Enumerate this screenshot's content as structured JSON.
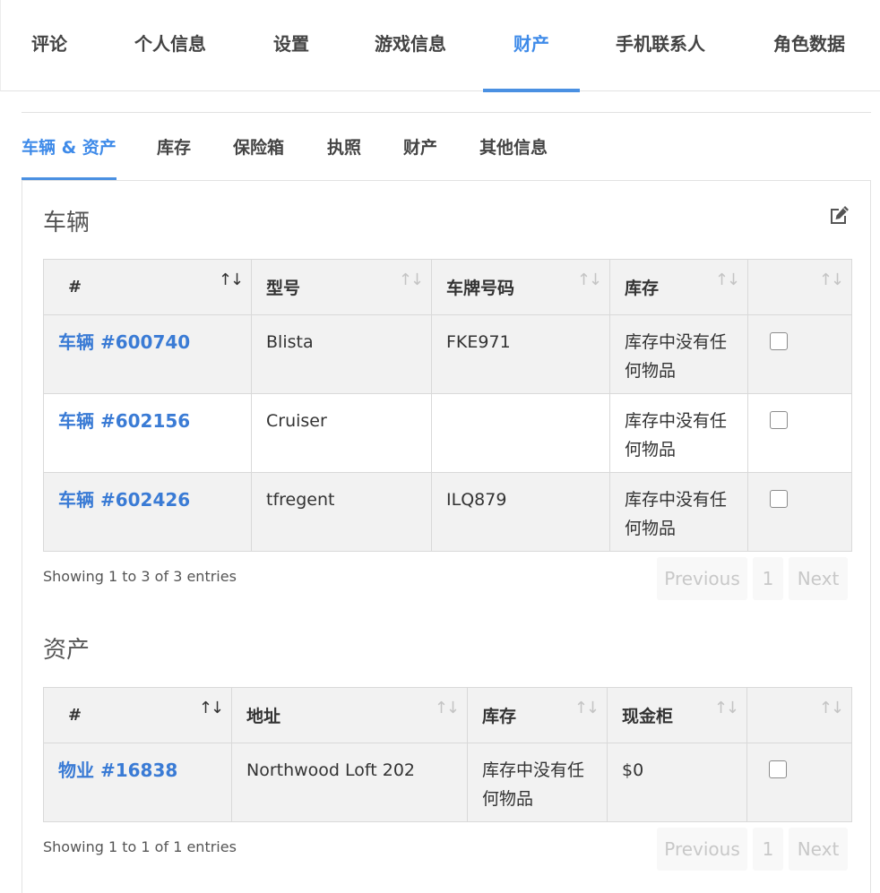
{
  "top_tabs": [
    "评论",
    "个人信息",
    "设置",
    "游戏信息",
    "财产",
    "手机联系人",
    "角色数据"
  ],
  "active_top_tab": "财产",
  "sub_tabs": [
    "车辆 & 资产",
    "库存",
    "保险箱",
    "执照",
    "财产",
    "其他信息"
  ],
  "active_sub_tab": "车辆 & 资产",
  "vehicles": {
    "title": "车辆",
    "columns": [
      "#",
      "型号",
      "车牌号码",
      "库存",
      ""
    ],
    "rows": [
      {
        "id": "车辆 #600740",
        "model": "Blista",
        "plate": "FKE971",
        "inventory": "库存中没有任何物品"
      },
      {
        "id": "车辆 #602156",
        "model": "Cruiser",
        "plate": "",
        "inventory": "库存中没有任何物品"
      },
      {
        "id": "车辆 #602426",
        "model": "tfregent",
        "plate": "ILQ879",
        "inventory": "库存中没有任何物品"
      }
    ],
    "info": "Showing 1 to 3 of 3 entries",
    "pager": {
      "previous": "Previous",
      "page": "1",
      "next": "Next"
    }
  },
  "properties": {
    "title": "资产",
    "columns": [
      "#",
      "地址",
      "库存",
      "现金柜",
      ""
    ],
    "rows": [
      {
        "id": "物业 #16838",
        "address": "Northwood Loft 202",
        "inventory": "库存中没有任何物品",
        "cash": "$0"
      }
    ],
    "info": "Showing 1 to 1 of 1 entries",
    "pager": {
      "previous": "Previous",
      "page": "1",
      "next": "Next"
    }
  },
  "colors": {
    "accent": "#3f8be9",
    "link": "#3a7bd5"
  },
  "icons": {
    "edit": "edit-icon",
    "sort": "sort-icon"
  }
}
